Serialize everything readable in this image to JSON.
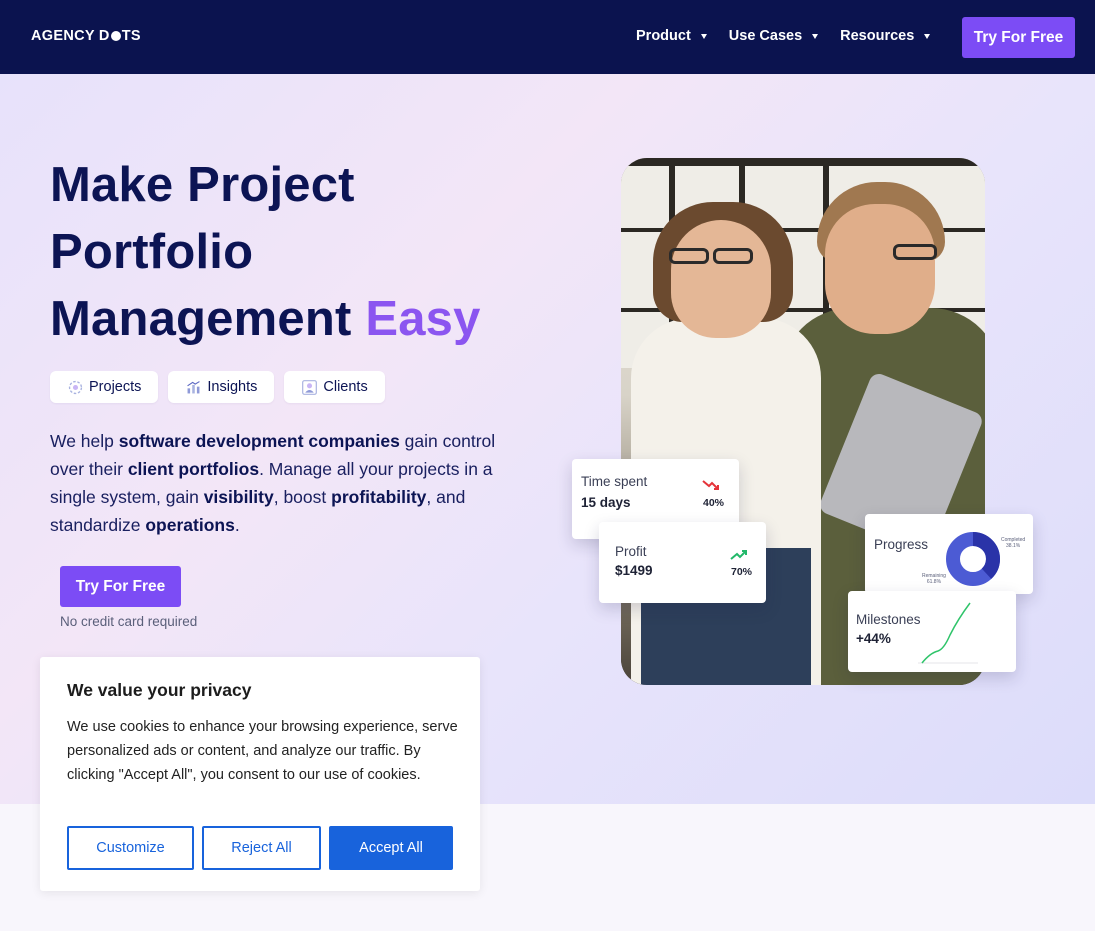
{
  "nav": {
    "logo_prefix": "AGENCY D",
    "logo_suffix": "TS",
    "menu": [
      {
        "label": "Product"
      },
      {
        "label": "Use Cases"
      },
      {
        "label": "Resources"
      }
    ],
    "cta": "Try For Free"
  },
  "hero": {
    "headline_line1": "Make Project",
    "headline_line2": "Portfolio",
    "headline_line3": "Management",
    "headline_accent": "Easy",
    "chips": [
      {
        "label": "Projects",
        "icon": "projects-icon"
      },
      {
        "label": "Insights",
        "icon": "insights-icon"
      },
      {
        "label": "Clients",
        "icon": "clients-icon"
      }
    ],
    "desc": {
      "p1": "We help ",
      "b1": "software development companies",
      "p2": " gain control over their ",
      "b2": "client portfolios",
      "p3": ". Manage all your projects in a single system, gain ",
      "b3": "visibility",
      "p4": ", boost ",
      "b4": "profitability",
      "p5": ", and standardize ",
      "b5": "operations",
      "p6": "."
    },
    "cta": "Try For Free",
    "cta_note": "No credit card required"
  },
  "cards": {
    "time_spent": {
      "label": "Time spent",
      "value": "15 days",
      "pct": "40%"
    },
    "profit": {
      "label": "Profit",
      "value": "$1499",
      "pct": "70%"
    },
    "progress": {
      "label": "Progress",
      "completed_label": "Completed",
      "completed_value": "38.1%",
      "remaining_label": "Remaining",
      "remaining_value": "61.8%"
    },
    "milestones": {
      "label": "Milestones",
      "value": "+44%"
    }
  },
  "colors": {
    "nav_bg": "#0b134f",
    "accent_purple": "#7c4cf5",
    "headline_accent": "#8b55f0",
    "cookie_blue": "#1863dc",
    "trend_down": "#e5343a",
    "trend_up": "#23b86a"
  },
  "cookie": {
    "title": "We value your privacy",
    "body": "We use cookies to enhance your browsing experience, serve personalized ads or content, and analyze our traffic. By clicking \"Accept All\", you consent to our use of cookies.",
    "customize": "Customize",
    "reject": "Reject All",
    "accept": "Accept All"
  }
}
